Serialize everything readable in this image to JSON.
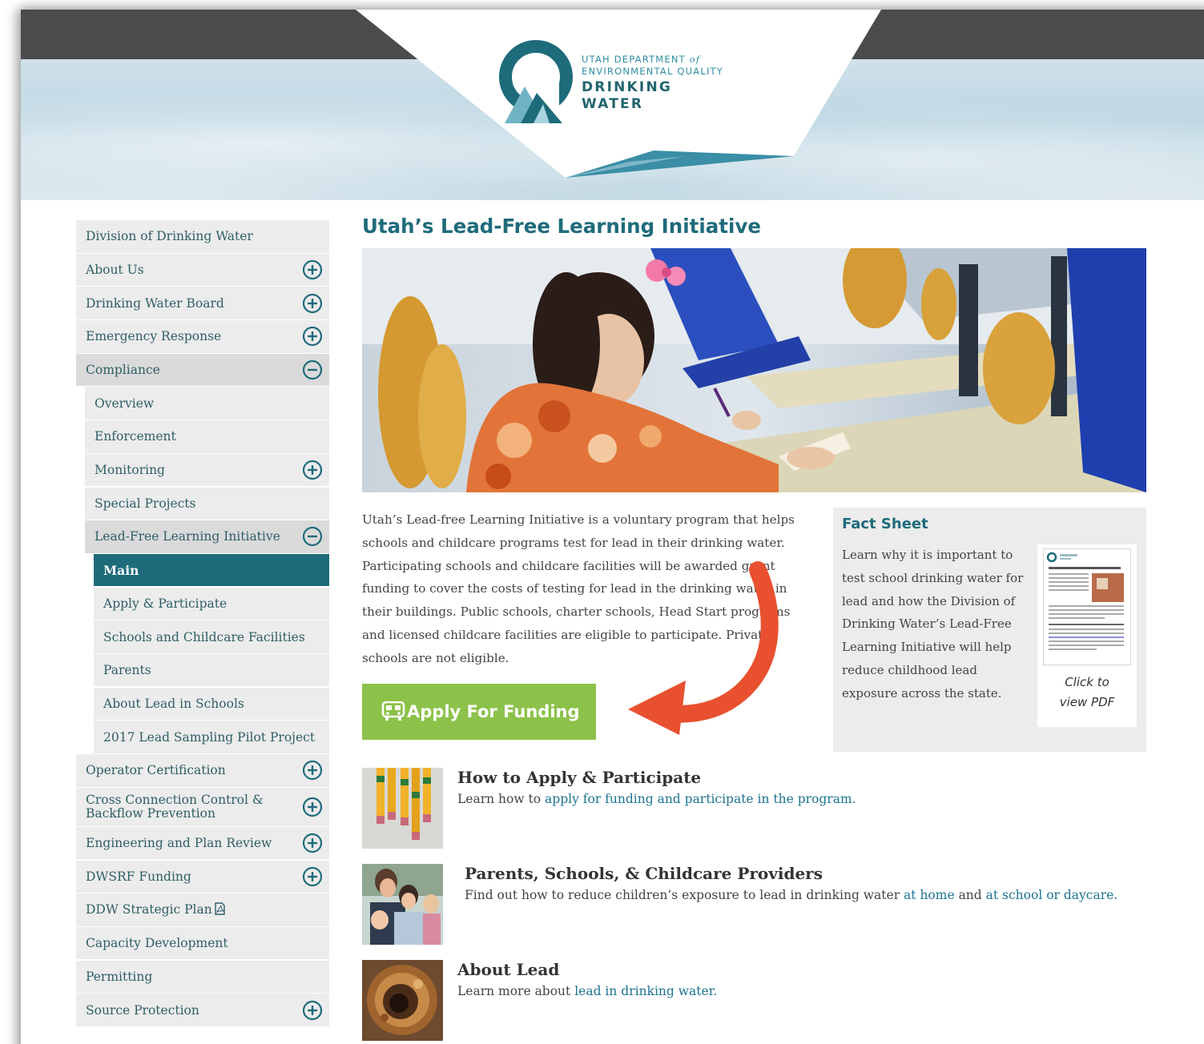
{
  "header": {
    "org_line1": "UTAH DEPARTMENT",
    "org_of": "of",
    "org_line2": "ENVIRONMENTAL QUALITY",
    "title_line1": "DRINKING",
    "title_line2": "WATER"
  },
  "sidebar": {
    "items": [
      {
        "label": "Division of Drinking Water",
        "level": 1,
        "toggle": "none"
      },
      {
        "label": "About Us",
        "level": 1,
        "toggle": "plus"
      },
      {
        "label": "Drinking Water Board",
        "level": 1,
        "toggle": "plus"
      },
      {
        "label": "Emergency Response",
        "level": 1,
        "toggle": "plus"
      },
      {
        "label": "Compliance",
        "level": 1,
        "toggle": "minus"
      },
      {
        "label": "Overview",
        "level": 2,
        "toggle": "none"
      },
      {
        "label": "Enforcement",
        "level": 2,
        "toggle": "none"
      },
      {
        "label": "Monitoring",
        "level": 2,
        "toggle": "plus"
      },
      {
        "label": "Special Projects",
        "level": 2,
        "toggle": "none"
      },
      {
        "label": "Lead-Free Learning Initiative",
        "level": 2,
        "toggle": "minus"
      },
      {
        "label": "Main",
        "level": 3,
        "toggle": "none",
        "current": true
      },
      {
        "label": "Apply & Participate",
        "level": 3,
        "toggle": "none"
      },
      {
        "label": "Schools and Childcare Facilities",
        "level": 3,
        "toggle": "none"
      },
      {
        "label": "Parents",
        "level": 3,
        "toggle": "none"
      },
      {
        "label": "About Lead in Schools",
        "level": 3,
        "toggle": "none"
      },
      {
        "label": "2017 Lead Sampling Pilot Project",
        "level": 3,
        "toggle": "none"
      },
      {
        "label": "Operator Certification",
        "level": 1,
        "toggle": "plus"
      },
      {
        "label_line1": "Cross Connection Control &",
        "label_line2": "Backflow Prevention",
        "level": 1,
        "toggle": "plus"
      },
      {
        "label": "Engineering and Plan Review",
        "level": 1,
        "toggle": "plus"
      },
      {
        "label": "DWSRF Funding",
        "level": 1,
        "toggle": "plus"
      },
      {
        "label": "DDW Strategic Plan",
        "level": 1,
        "toggle": "none",
        "icon": "pdf-icon"
      },
      {
        "label": "Capacity Development",
        "level": 1,
        "toggle": "none"
      },
      {
        "label": "Permitting",
        "level": 1,
        "toggle": "none"
      },
      {
        "label": "Source Protection",
        "level": 1,
        "toggle": "plus"
      }
    ]
  },
  "main": {
    "title": "Utah’s Lead-Free Learning Initiative",
    "intro": "Utah’s Lead-free Learning Initiative is a voluntary program that helps schools and childcare programs test for lead in their drinking water. Participating schools and childcare facilities will be awarded grant funding to cover the costs of testing for lead in the drinking water in their buildings. Public schools, charter schools, Head Start programs and licensed childcare facilities are eligible to participate. Private schools are not eligible.",
    "fund_button": "Apply For Funding",
    "fund_button_icon": "bus-icon",
    "accent_color": "#1e6b7b",
    "button_color": "#8cc24a",
    "arrow_color": "#e8502f"
  },
  "fact_sheet": {
    "title": "Fact Sheet",
    "text": "Learn why it is important to test school drinking water for lead and how the Division of Drinking Water’s Lead-Free Learning Initiative will help reduce childhood lead exposure across the state.",
    "caption_line1": "Click to",
    "caption_line2": "view PDF"
  },
  "features": [
    {
      "title": "How to Apply & Participate",
      "desc_prefix": "Learn how to ",
      "link1": "apply for funding and participate in the program.",
      "image": "pencils-photo"
    },
    {
      "title": "Parents, Schools, & Childcare Providers",
      "desc_prefix": "Find out how to reduce children’s exposure to lead in drinking water ",
      "link1": "at home",
      "desc_mid": " and ",
      "link2": "at school or daycare.",
      "image": "family-photo"
    },
    {
      "title": "About Lead",
      "desc_prefix": "Learn more about ",
      "link1": "lead in drinking water.",
      "image": "corroded-pipe-photo"
    }
  ]
}
